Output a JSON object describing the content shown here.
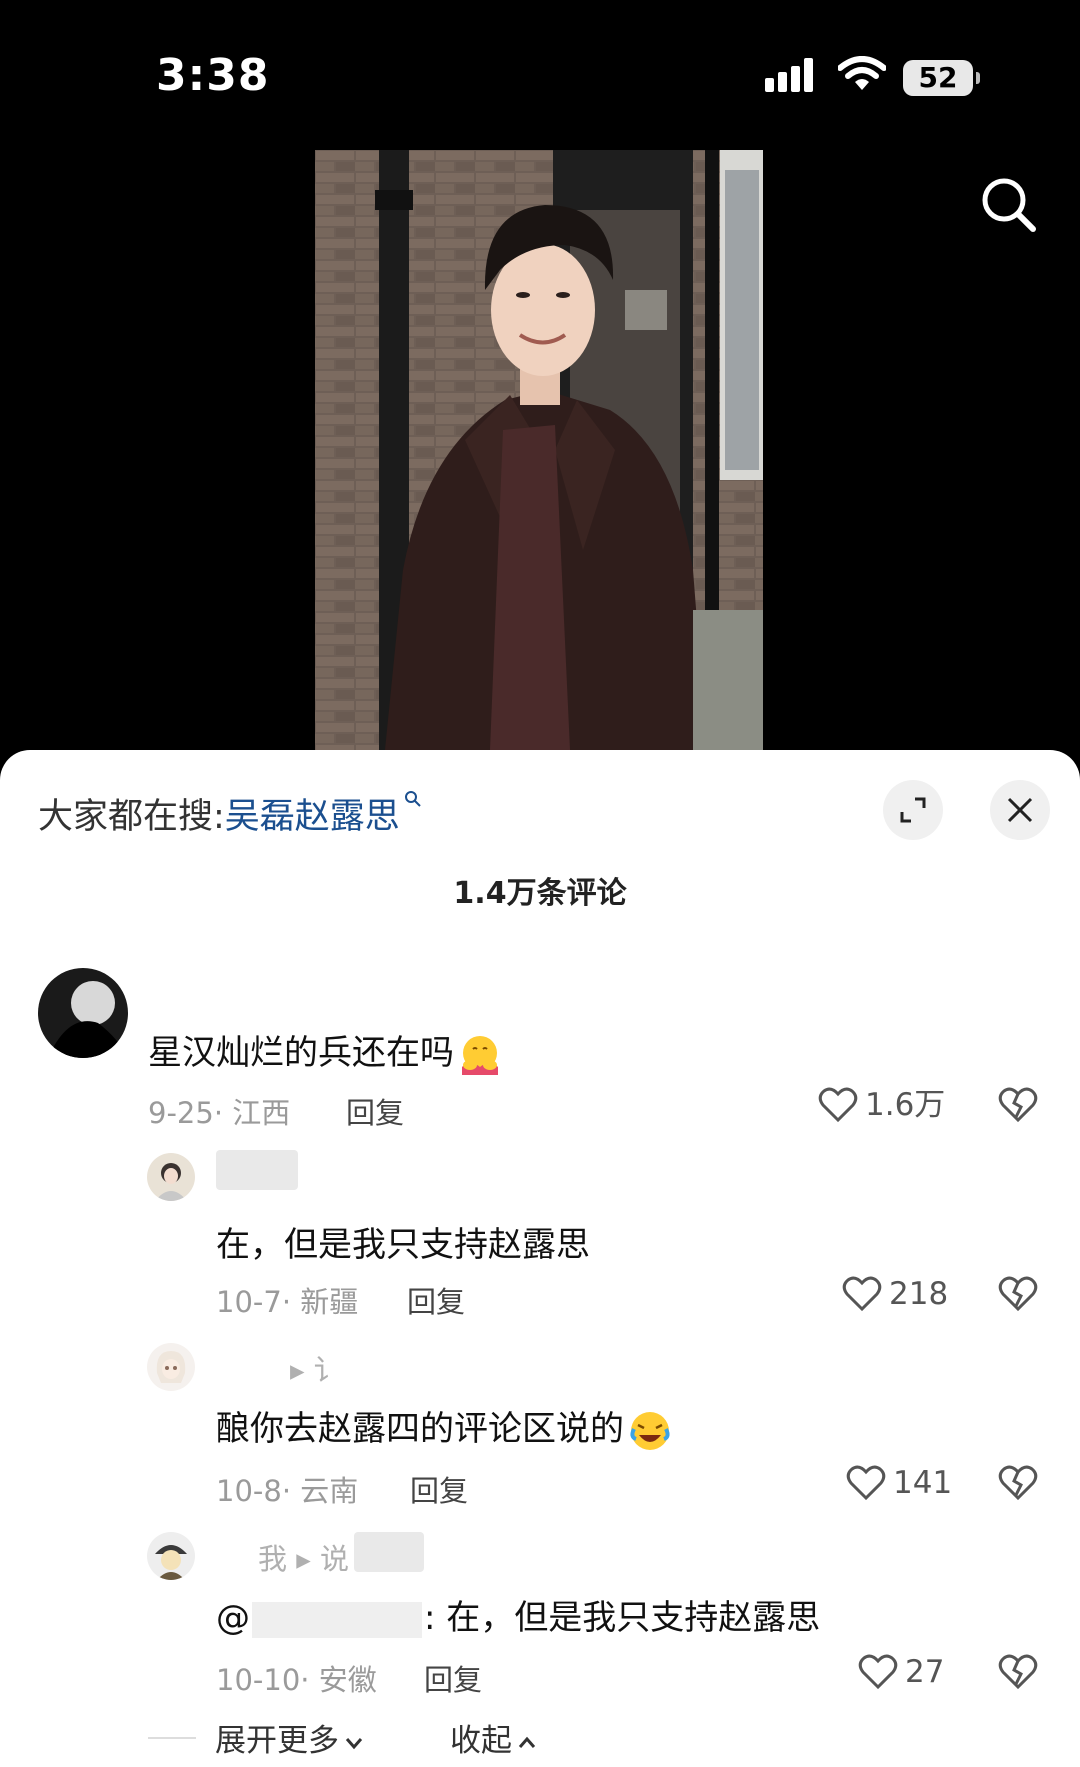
{
  "status_bar": {
    "time": "3:38",
    "battery": "52"
  },
  "sheet": {
    "search_label": "大家都在搜:",
    "search_keyword": "吴磊赵露思",
    "comment_count": "1.4万条评论"
  },
  "comments": [
    {
      "text": "星汉灿烂的兵还在吗",
      "date": "9-25",
      "region": "江西",
      "reply": "回复",
      "likes": "1.6万"
    }
  ],
  "replies": [
    {
      "text": "在，但是我只支持赵露思",
      "date": "10-7",
      "region": "新疆",
      "reply": "回复",
      "likes": "218"
    },
    {
      "name_partial": "▸ 讠",
      "text": "酿你去赵露四的评论区说的",
      "date": "10-8",
      "region": "云南",
      "reply": "回复",
      "likes": "141"
    },
    {
      "name_partial": "我 ▸ 说",
      "mention": "@",
      "text": ": 在，但是我只支持赵露思",
      "date": "10-10",
      "region": "安徽",
      "reply": "回复",
      "likes": "27"
    }
  ],
  "footer": {
    "expand_more": "展开更多",
    "collapse": "收起"
  },
  "colors": {
    "keyword": "#1b4f8f",
    "sheet_bg": "#ffffff",
    "background": "#000000"
  }
}
